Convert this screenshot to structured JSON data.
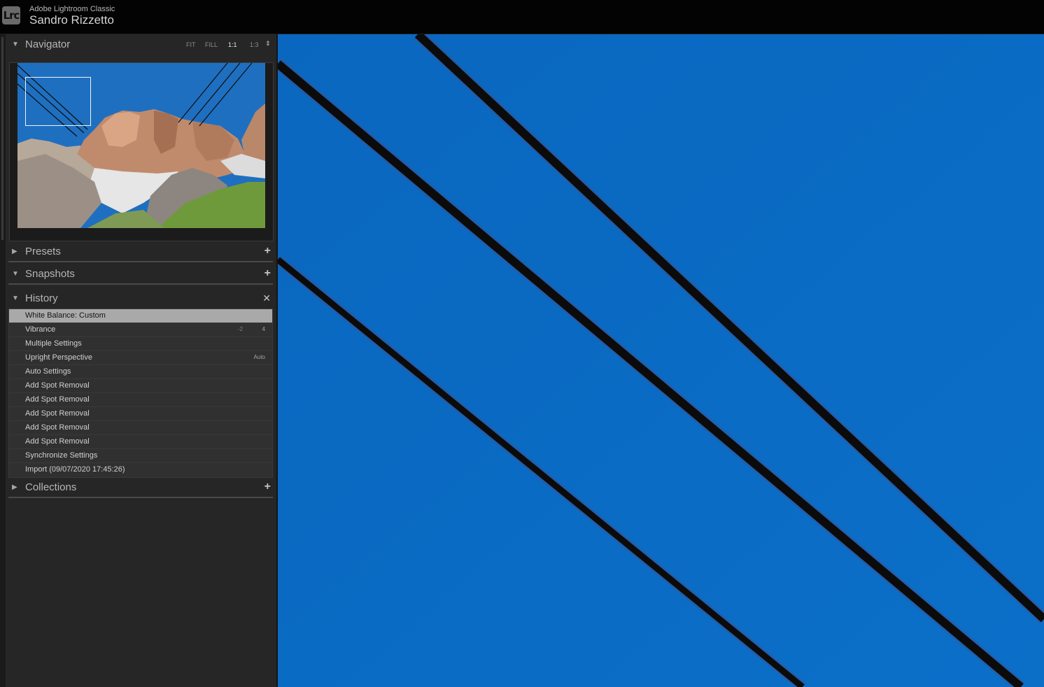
{
  "app": {
    "logo": "Lrc",
    "name": "Adobe Lightroom Classic",
    "user": "Sandro Rizzetto"
  },
  "navigator": {
    "title": "Navigator",
    "zoom_options": [
      "FIT",
      "FILL",
      "1:1",
      "1:3"
    ],
    "active_zoom": "1:1",
    "stepper_icon": "up-down-arrows-icon"
  },
  "presets": {
    "title": "Presets",
    "action_icon": "plus-dropdown-icon"
  },
  "snapshots": {
    "title": "Snapshots",
    "action_icon": "plus-icon"
  },
  "history": {
    "title": "History",
    "action_icon": "close-icon",
    "items": [
      {
        "label": "White Balance: Custom",
        "value_change": "",
        "value": "",
        "selected": true
      },
      {
        "label": "Vibrance",
        "value_change": "-2",
        "value": "4",
        "selected": false
      },
      {
        "label": "Multiple Settings",
        "value_change": "",
        "value": "",
        "selected": false
      },
      {
        "label": "Upright Perspective",
        "value_change": "",
        "value": "Auto",
        "selected": false
      },
      {
        "label": "Auto Settings",
        "value_change": "",
        "value": "",
        "selected": false
      },
      {
        "label": "Add Spot Removal",
        "value_change": "",
        "value": "",
        "selected": false
      },
      {
        "label": "Add Spot Removal",
        "value_change": "",
        "value": "",
        "selected": false
      },
      {
        "label": "Add Spot Removal",
        "value_change": "",
        "value": "",
        "selected": false
      },
      {
        "label": "Add Spot Removal",
        "value_change": "",
        "value": "",
        "selected": false
      },
      {
        "label": "Add Spot Removal",
        "value_change": "",
        "value": "",
        "selected": false
      },
      {
        "label": "Synchronize Settings",
        "value_change": "",
        "value": "",
        "selected": false
      },
      {
        "label": "Import (09/07/2020 17:45:26)",
        "value_change": "",
        "value": "",
        "selected": false
      }
    ]
  },
  "collections": {
    "title": "Collections",
    "action_icon": "plus-dropdown-icon"
  },
  "colors": {
    "sky": "#0b6cc4",
    "panel": "#262626",
    "selected_row": "#a9a9a9"
  }
}
